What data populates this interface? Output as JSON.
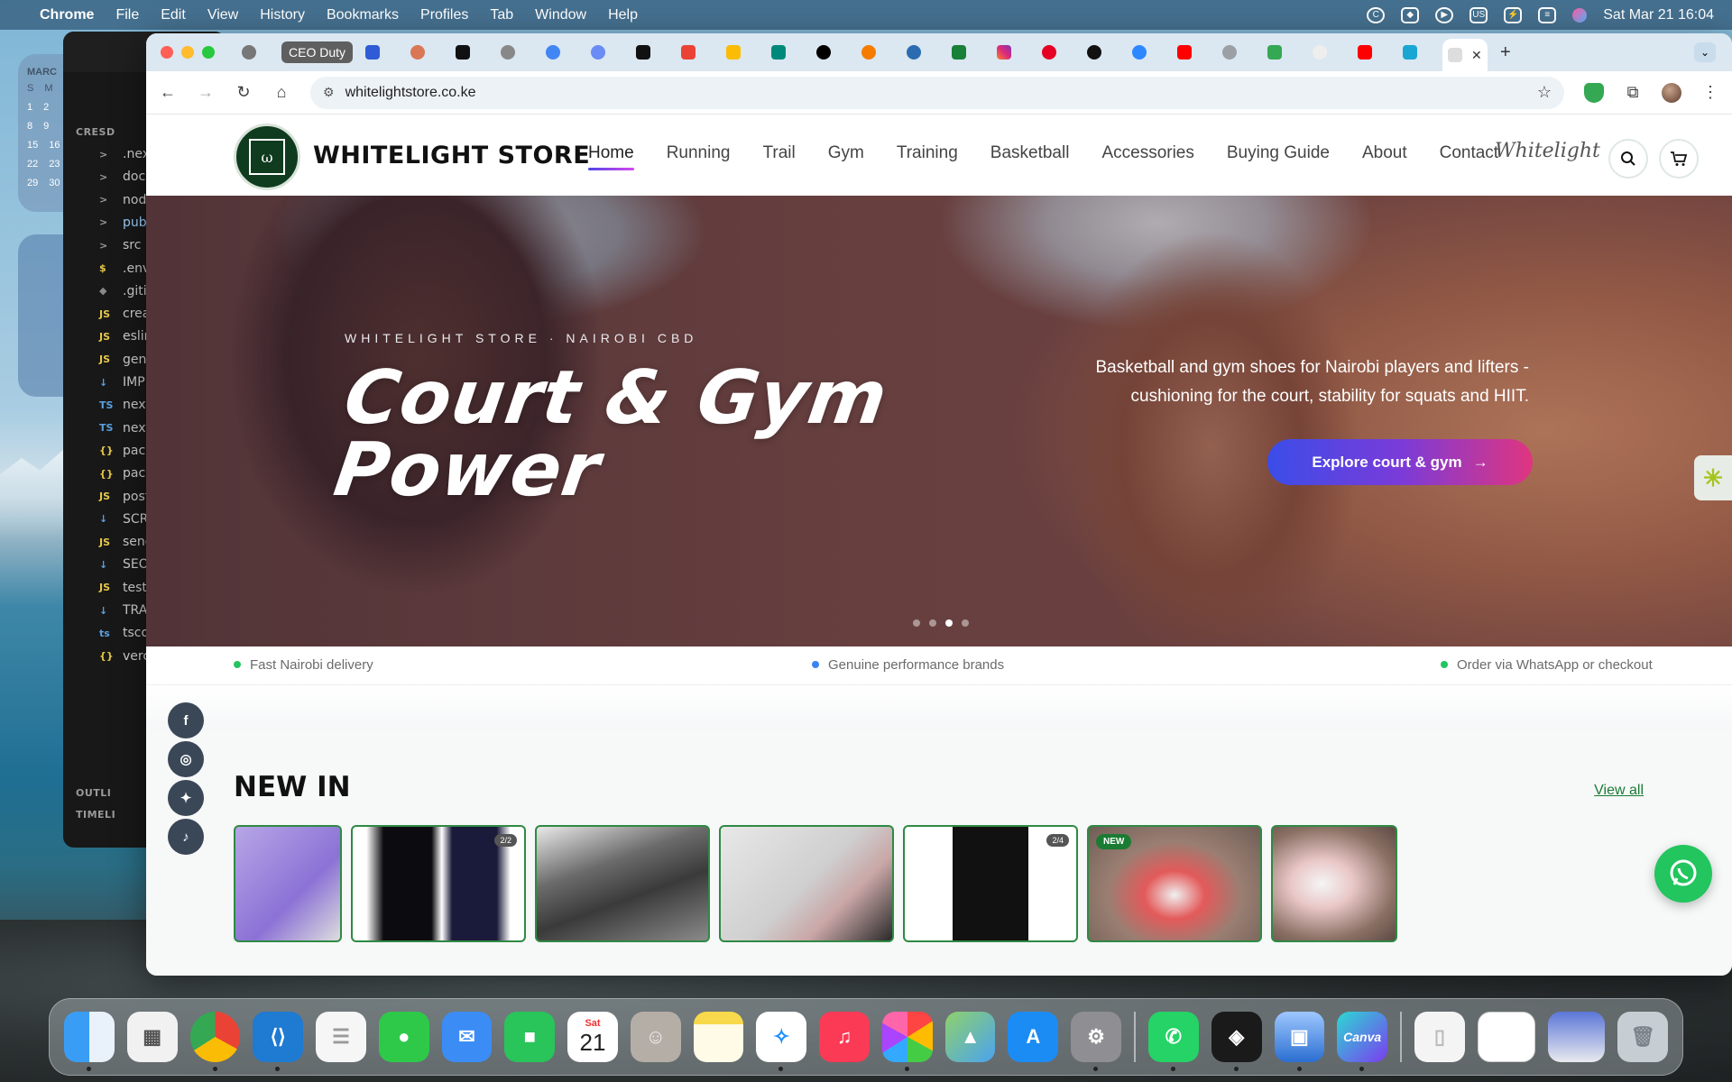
{
  "menubar": {
    "app_name": "Chrome",
    "menus": [
      "File",
      "Edit",
      "View",
      "History",
      "Bookmarks",
      "Profiles",
      "Tab",
      "Window",
      "Help"
    ],
    "status_input": "US",
    "datetime": "Sat Mar 21  16:04"
  },
  "widgets": {
    "calendar_month": "MARC",
    "calendar_header": [
      "S",
      "M"
    ],
    "calendar_rows": [
      [
        "1",
        "2"
      ],
      [
        "8",
        "9"
      ],
      [
        "15",
        "16"
      ],
      [
        "22",
        "23"
      ],
      [
        "29",
        "30"
      ]
    ]
  },
  "vscode": {
    "sections": [
      "CRESD",
      "OUTLI",
      "TIMELI"
    ],
    "files": [
      {
        "icon": ">",
        "name": ".nex"
      },
      {
        "icon": ">",
        "name": "docs"
      },
      {
        "icon": ">",
        "name": "nod"
      },
      {
        "icon": ">",
        "name": "publ"
      },
      {
        "icon": ">",
        "name": "src"
      },
      {
        "icon": "$",
        "name": ".env."
      },
      {
        "icon": "◆",
        "name": ".gitig"
      },
      {
        "icon": "JS",
        "name": "crea"
      },
      {
        "icon": "JS",
        "name": "eslin"
      },
      {
        "icon": "JS",
        "name": "gene"
      },
      {
        "icon": "↓",
        "name": "IMPL"
      },
      {
        "icon": "TS",
        "name": "next"
      },
      {
        "icon": "TS",
        "name": "next"
      },
      {
        "icon": "{}",
        "name": "pack"
      },
      {
        "icon": "{}",
        "name": "pack"
      },
      {
        "icon": "JS",
        "name": "post"
      },
      {
        "icon": "↓",
        "name": "SCR"
      },
      {
        "icon": "JS",
        "name": "send"
      },
      {
        "icon": "↓",
        "name": "SEO"
      },
      {
        "icon": "JS",
        "name": "test-"
      },
      {
        "icon": "↓",
        "name": "TRA"
      },
      {
        "icon": "ts",
        "name": "tsco"
      },
      {
        "icon": "{}",
        "name": "verc"
      }
    ]
  },
  "browser": {
    "tab_group_label": "CEO Duty",
    "url": "whitelightstore.co.ke",
    "new_tab_symbol": "+",
    "active_tab_close": "✕"
  },
  "site": {
    "brand": "WHITELIGHT STORE",
    "signature": "Whitelight",
    "nav": [
      "Home",
      "Running",
      "Trail",
      "Gym",
      "Training",
      "Basketball",
      "Accessories",
      "Buying Guide",
      "About",
      "Contact"
    ],
    "hero": {
      "kicker": "WHITELIGHT STORE · NAIROBI CBD",
      "title_line1": "Court & Gym",
      "title_line2": "Power",
      "description": "Basketball and gym shoes for Nairobi players and lifters - cushioning for the court, stability for squats and HIIT.",
      "cta": "Explore court & gym",
      "slides_total": 4,
      "slide_active": 3
    },
    "usps": [
      {
        "text": "Fast Nairobi delivery",
        "color": "#22c55e"
      },
      {
        "text": "Genuine performance brands",
        "color": "#3b82f6"
      },
      {
        "text": "Order via WhatsApp or checkout",
        "color": "#22c55e"
      }
    ],
    "new_in": {
      "title": "NEW IN",
      "view_all": "View all",
      "cards": [
        {
          "badge": "",
          "label": ""
        },
        {
          "badge": "2/2",
          "label": ""
        },
        {
          "badge": "",
          "label": ""
        },
        {
          "badge": "",
          "label": ""
        },
        {
          "badge": "2/4",
          "label": ""
        },
        {
          "badge": "",
          "label": "NEW"
        },
        {
          "badge": "",
          "label": ""
        }
      ]
    },
    "social": [
      "facebook-icon",
      "instagram-icon",
      "twitter-icon",
      "tiktok-icon"
    ],
    "colors": {
      "brand_green": "#0f3b1e",
      "accent_gradient_start": "#3b4de8",
      "accent_gradient_end": "#e0357f",
      "whatsapp": "#22c55e"
    }
  },
  "dock": {
    "calendar_day_label": "Sat",
    "calendar_day_number": "21",
    "canva_label": "Canva"
  }
}
